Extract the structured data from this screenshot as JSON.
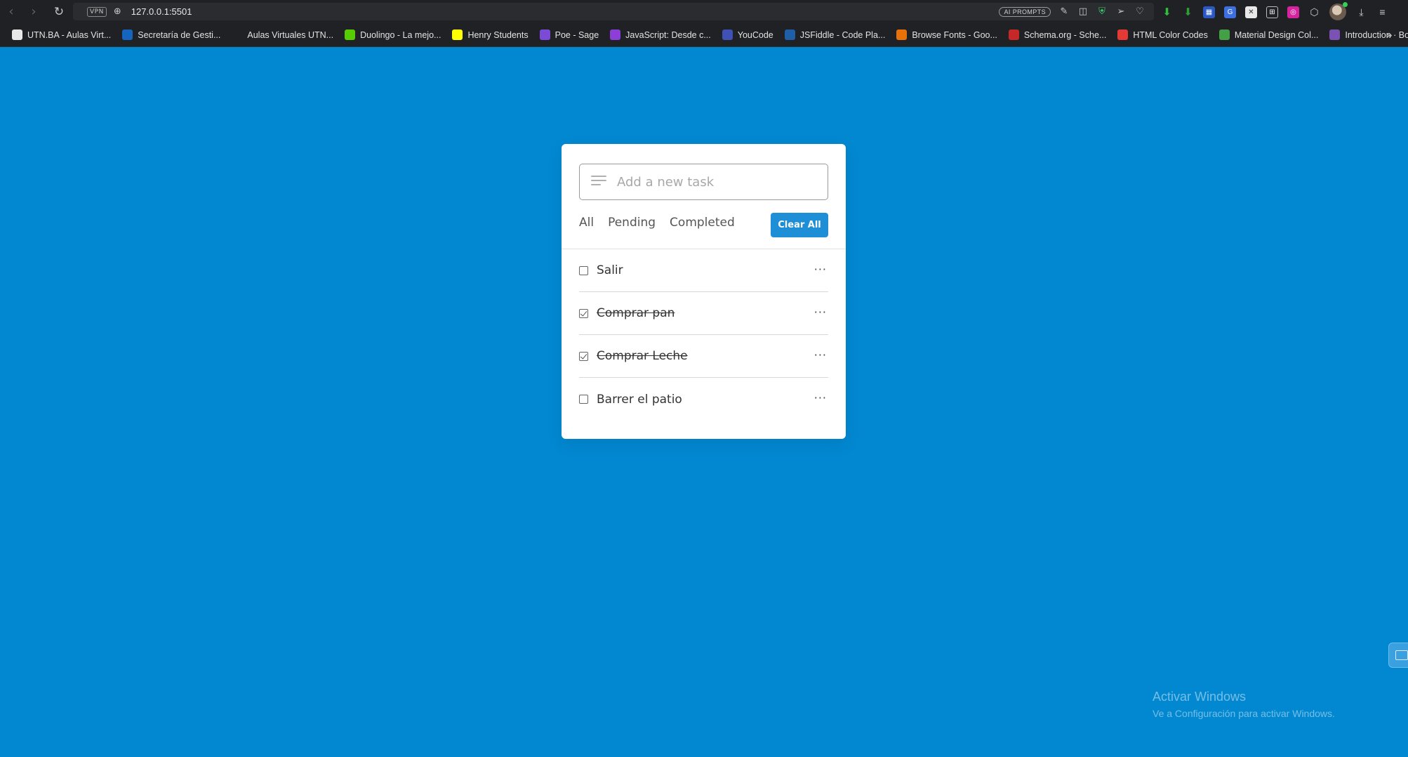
{
  "browser": {
    "url": "127.0.0.1:5501",
    "vpn_label": "VPN",
    "ai_prompts_label": "AI PROMPTS",
    "bookmarks": [
      {
        "label": "UTN.BA - Aulas Virt...",
        "icon": "document-icon",
        "color": "#e8e8e8"
      },
      {
        "label": "Secretaría de Gesti...",
        "icon": "utn-icon",
        "color": "#1565c0"
      },
      {
        "label": "Aulas Virtuales UTN...",
        "icon": "blank-icon",
        "color": "#202124"
      },
      {
        "label": "Duolingo - La mejo...",
        "icon": "duolingo-icon",
        "color": "#58cc02"
      },
      {
        "label": "Henry Students",
        "icon": "henry-icon",
        "color": "#ffff01"
      },
      {
        "label": "Poe - Sage",
        "icon": "poe-icon",
        "color": "#7b4bd8"
      },
      {
        "label": "JavaScript: Desde c...",
        "icon": "udemy-icon",
        "color": "#8b3fd6"
      },
      {
        "label": "YouCode",
        "icon": "youcode-icon",
        "color": "#3f51b5"
      },
      {
        "label": "JSFiddle - Code Pla...",
        "icon": "jsfiddle-icon",
        "color": "#1f5fa8"
      },
      {
        "label": "Browse Fonts - Goo...",
        "icon": "google-fonts-icon",
        "color": "#e8710a"
      },
      {
        "label": "Schema.org - Sche...",
        "icon": "schema-icon",
        "color": "#c62828"
      },
      {
        "label": "HTML Color Codes",
        "icon": "color-wheel-icon",
        "color": "#e53935"
      },
      {
        "label": "Material Design Col...",
        "icon": "material-icon",
        "color": "#43a047"
      },
      {
        "label": "Introduction · Boots...",
        "icon": "bootstrap-icon",
        "color": "#7952b3"
      }
    ]
  },
  "todo": {
    "input_placeholder": "Add a new task",
    "input_value": "",
    "filters": [
      "All",
      "Pending",
      "Completed"
    ],
    "clear_all_label": "Clear All",
    "tasks": [
      {
        "text": "Salir",
        "completed": false
      },
      {
        "text": "Comprar pan",
        "completed": true
      },
      {
        "text": "Comprar Leche",
        "completed": true
      },
      {
        "text": "Barrer el patio",
        "completed": false
      }
    ],
    "menu_glyph": "···"
  },
  "watermark": {
    "title": "Activar Windows",
    "subtitle": "Ve a Configuración para activar Windows."
  },
  "colors": {
    "page_background": "#0288d1",
    "accent_button": "#1e8fd6",
    "card_background": "#ffffff"
  }
}
